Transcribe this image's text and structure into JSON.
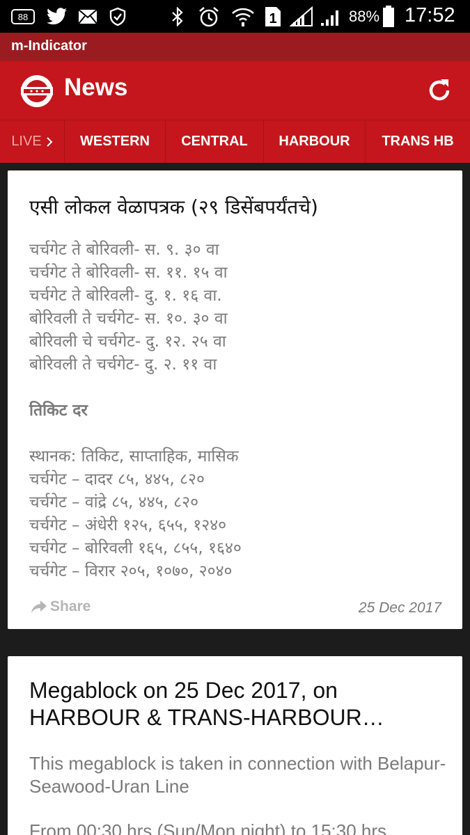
{
  "status_bar": {
    "notification_badge": "88",
    "battery_percent": "88%",
    "clock": "17:52",
    "sim_slot": "1",
    "icons": [
      "notification-count-icon",
      "twitter-icon",
      "mail-icon",
      "shield-icon",
      "bluetooth-icon",
      "alarm-icon",
      "wifi-icon",
      "sim-icon",
      "signal-icon",
      "signal-icon",
      "battery-icon"
    ]
  },
  "app": {
    "name": "m-Indicator",
    "screen_title": "News",
    "accent_color": "#c4161c",
    "dark_accent_color": "#9b1c20"
  },
  "tabs": [
    {
      "label": "LIVE"
    },
    {
      "label": "WESTERN"
    },
    {
      "label": "CENTRAL"
    },
    {
      "label": "HARBOUR"
    },
    {
      "label": "TRANS HB"
    }
  ],
  "news": [
    {
      "title": "एसी लोकल वेळापत्रक (२९ डिसेंबपर्यंतचे)",
      "lines": [
        "चर्चगेट ते बोरिवली- स. ९. ३० वा",
        "चर्चगेट ते बोरिवली- स. ११. १५ वा",
        "चर्चगेट ते बोरिवली- दु. १. १६ वा.",
        "बोरिवली ते चर्चगेट- स. १०. ३० वा",
        "बोरिवली चे चर्चगेट- दु. १२. २५ वा",
        "बोरिवली ते चर्चगेट- दु. २. ११ वा"
      ],
      "subheading": "तिकिट दर",
      "fare_lines": [
        "स्थानक: तिकिट, साप्ताहिक, मासिक",
        "चर्चगेट – दादर ८५, ४४५, ८२०",
        "चर्चगेट – वांद्रे ८५, ४४५, ८२०",
        "चर्चगेट – अंधेरी १२५, ६५५, १२४०",
        "चर्चगेट – बोरिवली १६५, ८५५, १६४०",
        "चर्चगेट – विरार २०५, १०७०, २०४०"
      ],
      "share_label": "Share",
      "date": "25 Dec 2017"
    },
    {
      "title": "Megablock on 25 Dec 2017, on HARBOUR & TRANS-HARBOUR…",
      "body": "This megablock is taken in connection with Belapur-Seawood-Uran Line",
      "body_partial": "From 00:30 hrs (Sun/Mon night) to 15:30 hrs"
    }
  ]
}
